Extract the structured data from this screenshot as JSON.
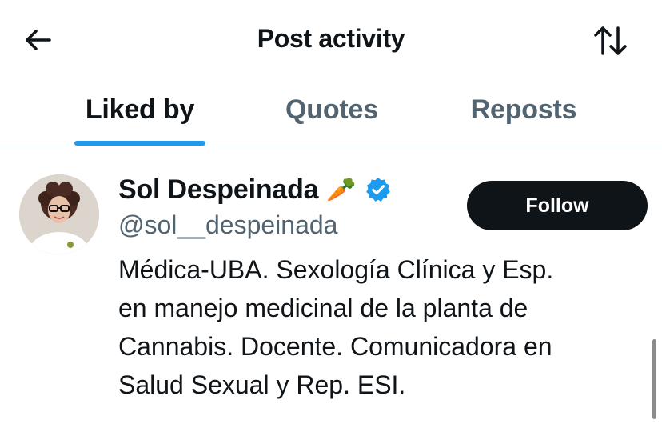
{
  "header": {
    "title": "Post activity",
    "back_icon": "arrow-left-icon",
    "sort_icon": "sort-arrows-icon"
  },
  "tabs": [
    {
      "label": "Liked by",
      "active": true
    },
    {
      "label": "Quotes",
      "active": false
    },
    {
      "label": "Reposts",
      "active": false
    }
  ],
  "user": {
    "name": "Sol Despeinada",
    "emoji": "🥕",
    "verified": true,
    "handle": "@sol__despeinada",
    "follow_label": "Follow",
    "bio_lines": [
      "Médica-UBA. Sexología Clínica y Esp.",
      "en manejo medicinal de la planta de",
      "Cannabis. Docente. Comunicadora en",
      "Salud Sexual y Rep. ESI."
    ]
  },
  "colors": {
    "accent": "#1d9bf0",
    "text": "#0f1419",
    "secondary": "#536471",
    "button_bg": "#0f1419"
  }
}
